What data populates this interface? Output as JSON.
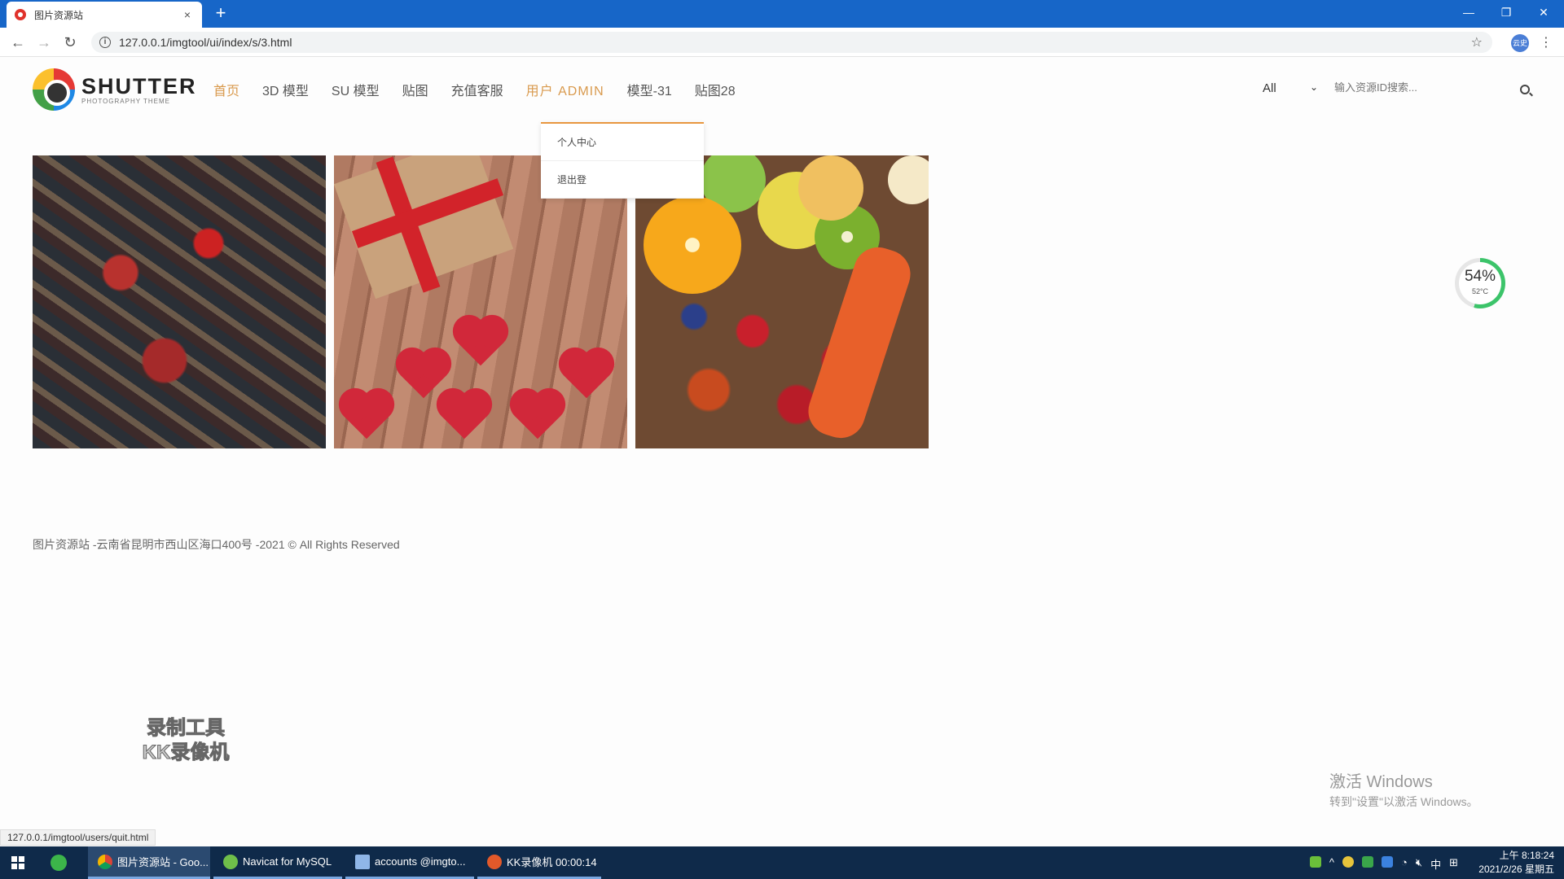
{
  "browser": {
    "tab_title": "图片资源站",
    "tab_close": "×",
    "new_tab": "+",
    "url": "127.0.0.1/imgtool/ui/index/s/3.html",
    "status_url": "127.0.0.1/imgtool/users/quit.html",
    "minimize": "—",
    "restore": "❐",
    "close": "✕",
    "back": "←",
    "forward": "→",
    "reload": "↻",
    "profile": "云史"
  },
  "site": {
    "logo_main": "SHUTTER",
    "logo_sub": "PHOTOGRAPHY THEME",
    "nav": [
      {
        "label": "首页"
      },
      {
        "label": "3D 模型"
      },
      {
        "label": "SU 模型"
      },
      {
        "label": "贴图"
      },
      {
        "label": "充值客服"
      },
      {
        "label": "用户 ADMIN"
      },
      {
        "label": "模型-31"
      },
      {
        "label": "贴图28"
      }
    ],
    "dropdown": [
      {
        "label": "个人中心"
      },
      {
        "label": "退出登"
      }
    ],
    "search": {
      "category": "All",
      "placeholder": "输入资源ID搜索..."
    },
    "footer": "图片资源站 -云南省昆明市西山区海口400号 -2021 © All Rights Reserved"
  },
  "overlays": {
    "gauge_value": "54%",
    "gauge_temp": "52°C",
    "recorder_watermark_line1": "录制工具",
    "recorder_watermark_line2": "KK录像机",
    "activate_title": "激活 Windows",
    "activate_sub": "转到\"设置\"以激活 Windows。"
  },
  "taskbar": {
    "tasks": [
      {
        "label": "图片资源站 - Goo..."
      },
      {
        "label": "Navicat for MySQL"
      },
      {
        "label": "accounts @imgto..."
      },
      {
        "label": "KK录像机 00:00:14"
      }
    ],
    "ime": "中",
    "time": "上午 8:18:24",
    "date": "2021/2/26 星期五"
  },
  "colors": {
    "accent": "#d99a4e",
    "chrome_blue": "#1766c8",
    "taskbar": "#0f2a4a"
  }
}
